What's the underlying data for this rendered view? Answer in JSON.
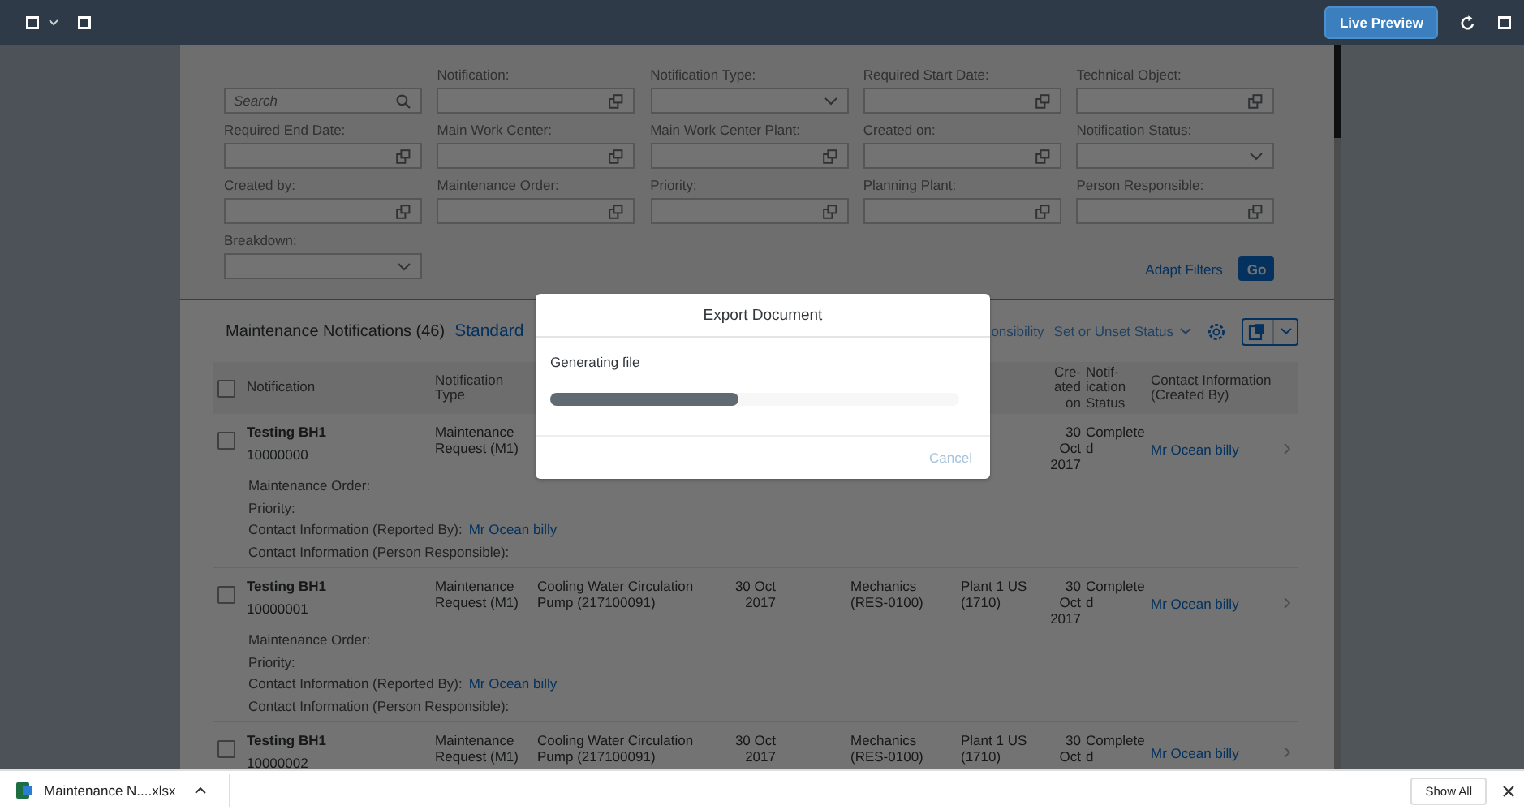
{
  "top_bar": {
    "live_preview": "Live Preview"
  },
  "filter_bar": {
    "fields": [
      {
        "kind": "search",
        "placeholder": "Search"
      },
      {
        "kind": "valuehelp",
        "label": "Notification:"
      },
      {
        "kind": "dropdown",
        "label": "Notification Type:"
      },
      {
        "kind": "valuehelp",
        "label": "Required Start Date:"
      },
      {
        "kind": "valuehelp",
        "label": "Technical Object:"
      },
      {
        "kind": "valuehelp",
        "label": "Required End Date:"
      },
      {
        "kind": "valuehelp",
        "label": "Main Work Center:"
      },
      {
        "kind": "valuehelp",
        "label": "Main Work Center Plant:"
      },
      {
        "kind": "valuehelp",
        "label": "Created on:"
      },
      {
        "kind": "dropdown",
        "label": "Notification Status:"
      },
      {
        "kind": "valuehelp",
        "label": "Created by:"
      },
      {
        "kind": "valuehelp",
        "label": "Maintenance Order:"
      },
      {
        "kind": "valuehelp",
        "label": "Priority:"
      },
      {
        "kind": "valuehelp",
        "label": "Planning Plant:"
      },
      {
        "kind": "valuehelp",
        "label": "Person Responsible:"
      },
      {
        "kind": "dropdown",
        "label": "Breakdown:"
      }
    ],
    "adapt_filters": "Adapt Filters",
    "go": "Go"
  },
  "table": {
    "title": "Maintenance Notifications (46)",
    "variant": "Standard",
    "toolbar_fragment": "onsibility",
    "status_menu": "Set or Unset Status",
    "select_all_checked": false,
    "columns": [
      "Notification",
      "Notification\nType",
      "Cre-\nated\non",
      "Notif-\nication\nStatus",
      "Contact Information\n(Created By)"
    ],
    "rows": [
      {
        "checked": false,
        "title": "Testing BH1",
        "number": "10000000",
        "type": "Maintenance\nRequest (M1)",
        "created_on": "30\nOct\n2017",
        "status": "Complete\nd",
        "contact": "Mr Ocean billy",
        "details": [
          {
            "label": "Maintenance Order:"
          },
          {
            "label": "Priority:"
          },
          {
            "label": "Contact Information (Reported By):",
            "link": "Mr Ocean billy"
          },
          {
            "label": "Contact Information (Person Responsible):"
          }
        ]
      },
      {
        "checked": false,
        "title": "Testing BH1",
        "number": "10000001",
        "type": "Maintenance\nRequest (M1)",
        "technical_object": "Cooling Water Circulation\nPump (217100091)",
        "start_date": "30 Oct\n2017",
        "work_center": "Mechanics\n(RES-0100)",
        "plant": "Plant 1 US\n(1710)",
        "created_on": "30\nOct\n2017",
        "status": "Complete\nd",
        "contact": "Mr Ocean billy",
        "details": [
          {
            "label": "Maintenance Order:"
          },
          {
            "label": "Priority:"
          },
          {
            "label": "Contact Information (Reported By):",
            "link": "Mr Ocean billy"
          },
          {
            "label": "Contact Information (Person Responsible):"
          }
        ]
      },
      {
        "checked": false,
        "title": "Testing BH1",
        "number": "10000002",
        "type": "Maintenance\nRequest (M1)",
        "technical_object": "Cooling Water Circulation\nPump (217100091)",
        "start_date": "30 Oct\n2017",
        "work_center": "Mechanics\n(RES-0100)",
        "plant": "Plant 1 US\n(1710)",
        "created_on": "30\nOct",
        "status": "Complete\nd",
        "contact": "Mr Ocean billy"
      }
    ]
  },
  "dialog": {
    "title": "Export Document",
    "message": "Generating file",
    "level": 0.46,
    "cancel": {
      "label": "Cancel",
      "disabled": true
    }
  },
  "download_bar": {
    "file": "Maintenance N....xlsx",
    "show_all": "Show All"
  }
}
